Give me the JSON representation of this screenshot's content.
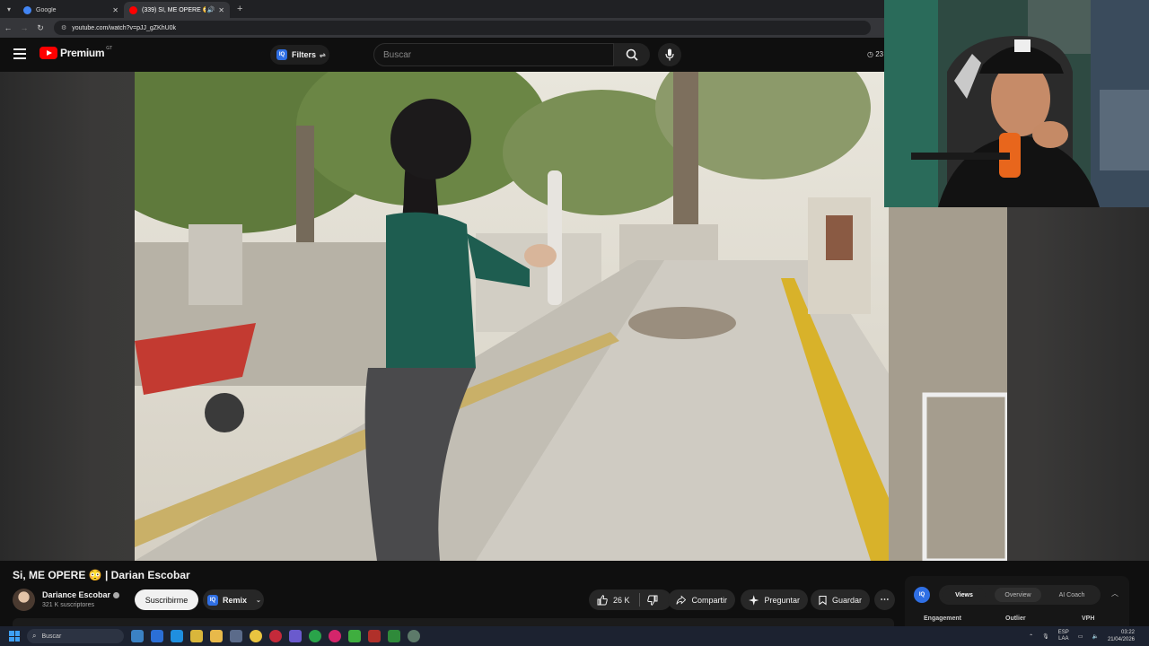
{
  "browser": {
    "tabs": [
      {
        "title": "Google",
        "favicon_color": "#4285f4"
      },
      {
        "title": "(339) SI, ME OPERE 😳 | Da...",
        "favicon_color": "#ff0000"
      }
    ],
    "new_tab_label": "+",
    "url": "youtube.com/watch?v=pJJ_gZKhU0k"
  },
  "header": {
    "logo_text": "Premium",
    "country_code": "GT",
    "filters_label": "Filters",
    "search_placeholder": "Buscar",
    "timer_text": "23"
  },
  "video": {
    "title": "Si, ME OPERE 😳 | Darian Escobar",
    "channel_name": "Dariance Escobar",
    "subscribers": "321 K suscriptores",
    "subscribe_label": "Suscribirme",
    "remix_label": "Remix",
    "likes": "26 K",
    "share_label": "Compartir",
    "ask_label": "Preguntar",
    "save_label": "Guardar"
  },
  "iq_panel": {
    "badge": "IQ",
    "tabs": [
      "Views",
      "Overview",
      "AI Coach"
    ],
    "active_tab": "Views",
    "columns": [
      "Engagement",
      "Outlier",
      "VPH"
    ]
  },
  "taskbar": {
    "search_placeholder": "Buscar",
    "language_top": "ESP",
    "language_bottom": "LAA",
    "time": "03:22",
    "date": "21/04/2026"
  }
}
